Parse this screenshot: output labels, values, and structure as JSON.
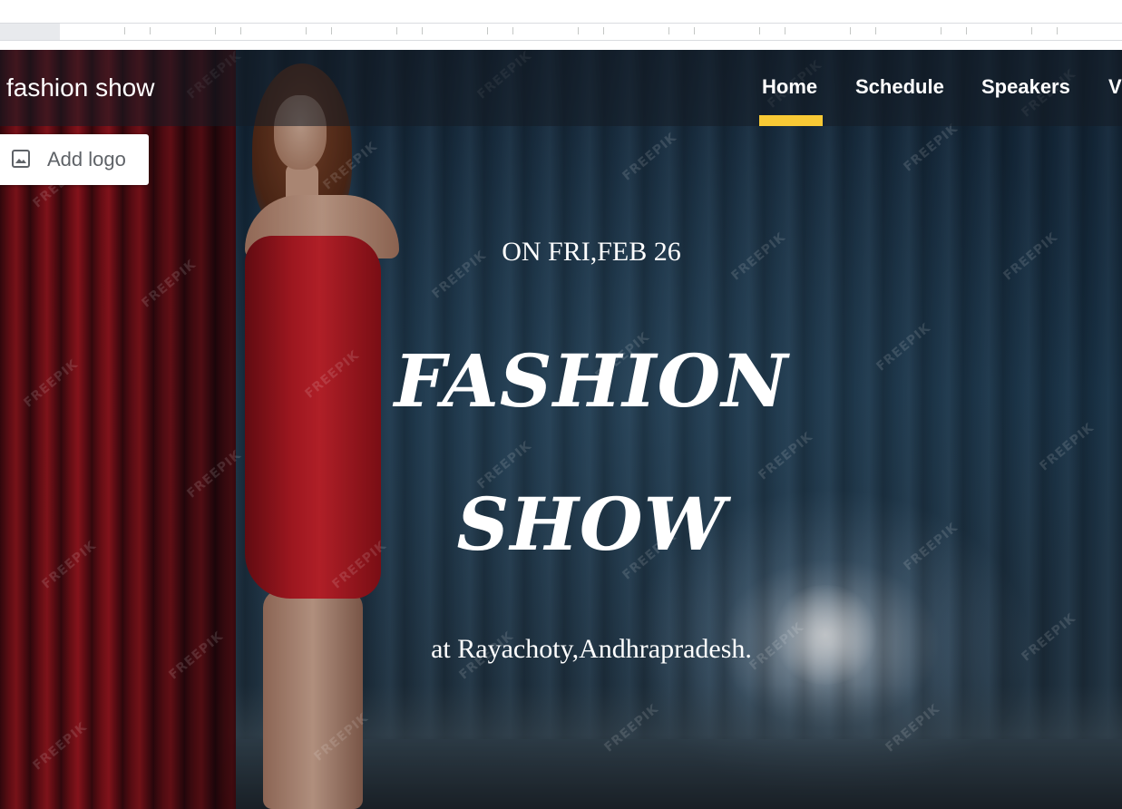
{
  "nav": {
    "site_title": "fashion show",
    "items": [
      {
        "label": "Home",
        "active": true
      },
      {
        "label": "Schedule",
        "active": false
      },
      {
        "label": "Speakers",
        "active": false
      },
      {
        "label": "V",
        "active": false
      }
    ],
    "active_indicator_color": "#f8c935"
  },
  "add_logo": {
    "label": "Add logo",
    "icon": "image-icon"
  },
  "hero": {
    "date": "ON FRI,FEB 26",
    "title_line_1": "FASHION",
    "title_line_2": "SHOW",
    "location": "at Rayachoty,Andhrapradesh.",
    "watermark": "FREEPIK"
  }
}
